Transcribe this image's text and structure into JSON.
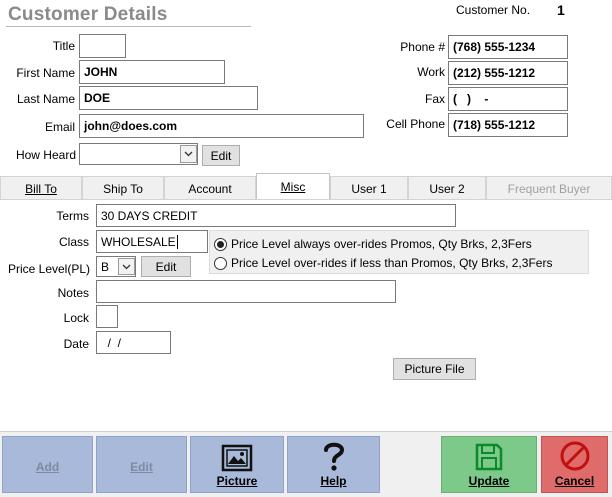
{
  "header": {
    "title": "Customer Details",
    "customer_no_label": "Customer No.",
    "customer_no_value": "1"
  },
  "contact": {
    "title_label": "Title",
    "title_value": "",
    "first_name_label": "First Name",
    "first_name_value": "JOHN",
    "last_name_label": "Last Name",
    "last_name_value": "DOE",
    "email_label": "Email",
    "email_value": "john@does.com",
    "how_heard_label": "How Heard",
    "how_heard_value": "",
    "edit_label": "Edit",
    "phone_label": "Phone #",
    "phone_value": "(768) 555-1234",
    "work_label": "Work",
    "work_value": "(212) 555-1212",
    "fax_label": "Fax",
    "fax_value": "(   )    -",
    "cell_label": "Cell Phone",
    "cell_value": "(718) 555-1212"
  },
  "tabs": [
    {
      "label": "Bill To"
    },
    {
      "label": "Ship To"
    },
    {
      "label": "Account"
    },
    {
      "label": "Misc"
    },
    {
      "label": "User 1"
    },
    {
      "label": "User 2"
    },
    {
      "label": "Frequent Buyer"
    }
  ],
  "active_tab": "Misc",
  "misc": {
    "terms_label": "Terms",
    "terms_value": "30 DAYS CREDIT",
    "class_label": "Class",
    "class_value": "WHOLESALE",
    "price_level_label": "Price Level(PL)",
    "price_level_value": "B",
    "edit_label": "Edit",
    "radio_always": "Price Level  always over-rides Promos, Qty Brks, 2,3Fers",
    "radio_if_less": "Price Level over-rides if less than Promos, Qty Brks, 2,3Fers",
    "radio_selected": "always",
    "notes_label": "Notes",
    "notes_value": "",
    "lock_label": "Lock",
    "lock_value": "",
    "date_label": "Date",
    "date_value": "  /  /",
    "picture_file_label": "Picture File"
  },
  "toolbar": {
    "add_label": "Add",
    "edit_label": "Edit",
    "picture_label": "Picture",
    "help_label": "Help",
    "update_label": "Update",
    "cancel_label": "Cancel"
  },
  "icons": {
    "picture": "picture-icon",
    "help": "question-mark-icon",
    "update": "floppy-disk-icon",
    "cancel": "no-entry-icon",
    "dropdown": "chevron-down-icon"
  },
  "colors": {
    "toolbar_blue": "#a9b9d9",
    "update_green": "#7dc98a",
    "cancel_red": "#e06b6b",
    "title_gray": "#8a8a8a"
  }
}
